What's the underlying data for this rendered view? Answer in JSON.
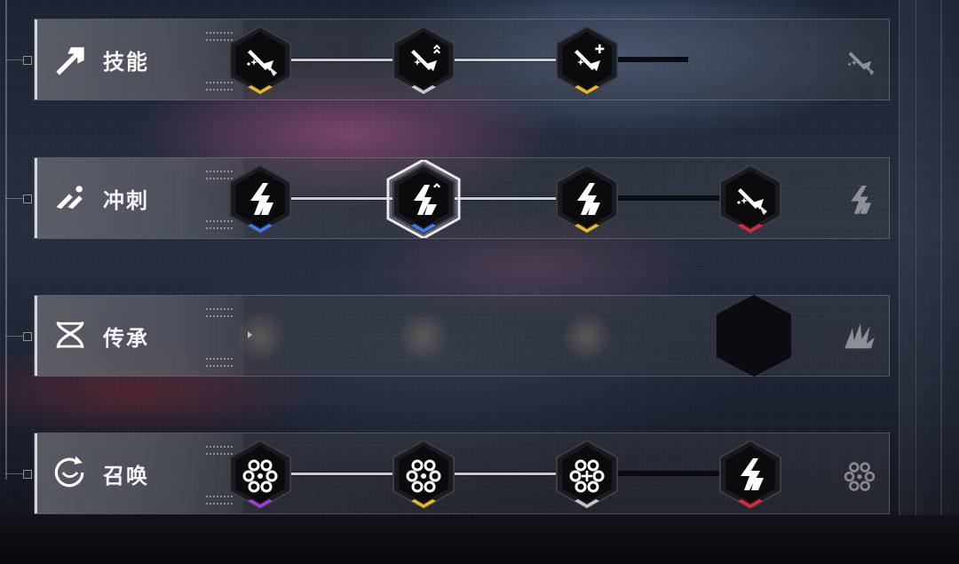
{
  "colors": {
    "gold": "#e9b823",
    "silver": "#c8c8cc",
    "blue": "#3d7cf0",
    "red": "#e0283a",
    "purple": "#a23bd8"
  },
  "rows": [
    {
      "label": "技能",
      "icon": "skill-arrow-icon",
      "nodes": [
        {
          "icon": "sword-burst-icon",
          "tier": "gold"
        },
        {
          "icon": "sword-burst-up-icon",
          "tier": "silver"
        },
        {
          "icon": "sword-burst-plus-icon",
          "tier": "gold"
        }
      ],
      "locked_icon": "sword-burst-icon"
    },
    {
      "label": "冲刺",
      "icon": "dash-icon",
      "nodes": [
        {
          "icon": "lightning-dash-icon",
          "tier": "blue"
        },
        {
          "icon": "lightning-dash-up-icon",
          "tier": "blue",
          "selected": true
        },
        {
          "icon": "lightning-dash-icon",
          "tier": "gold"
        },
        {
          "icon": "sword-burst-icon",
          "tier": "red"
        }
      ],
      "locked_icon": "lightning-dash-icon"
    },
    {
      "label": "传承",
      "icon": "dna-icon",
      "nodes": [],
      "locked_icon": "claw-icon"
    },
    {
      "label": "召唤",
      "icon": "summon-icon",
      "nodes": [
        {
          "icon": "summon-circle-icon",
          "tier": "purple"
        },
        {
          "icon": "summon-circle-icon",
          "tier": "gold"
        },
        {
          "icon": "summon-circle-plus-icon",
          "tier": "silver"
        },
        {
          "icon": "lightning-dash-icon",
          "tier": "red"
        }
      ],
      "locked_icon": "summon-circle-icon"
    }
  ]
}
